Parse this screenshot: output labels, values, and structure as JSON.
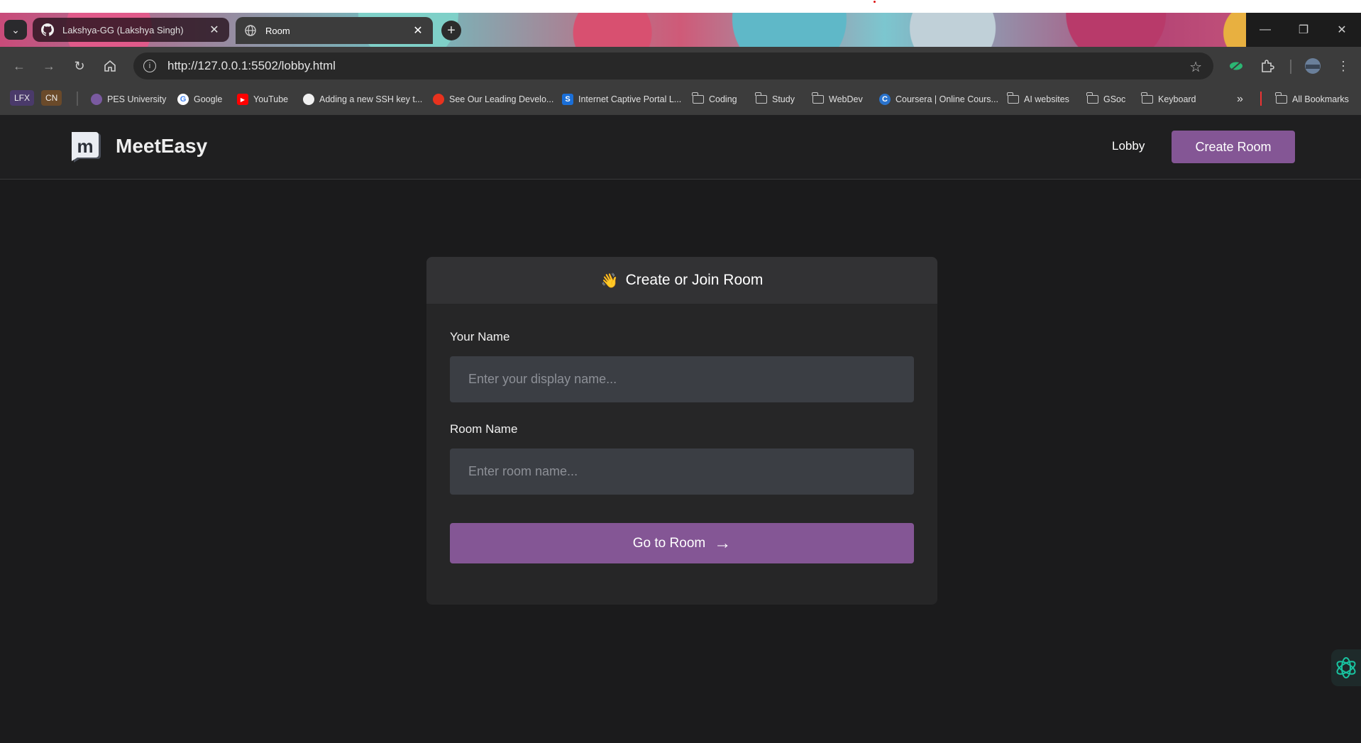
{
  "browser": {
    "tabs": [
      {
        "title": "Lakshya-GG (Lakshya Singh)",
        "icon": "github-icon",
        "active": false
      },
      {
        "title": "Room",
        "icon": "globe-icon",
        "active": true
      }
    ],
    "new_tab_symbol": "+",
    "tab_close_symbol": "✕",
    "url": "http://127.0.0.1:5502/lobby.html",
    "bookmarks": {
      "chips": [
        "LFX",
        "CN"
      ],
      "items": [
        {
          "label": "PES University",
          "icon": "pes-icon"
        },
        {
          "label": "Google",
          "icon": "google-icon"
        },
        {
          "label": "YouTube",
          "icon": "youtube-icon"
        },
        {
          "label": "Adding a new SSH key t...",
          "icon": "github-icon"
        },
        {
          "label": "See Our Leading Develo...",
          "icon": "red-circle-icon"
        },
        {
          "label": "Internet Captive Portal L...",
          "icon": "sophos-icon"
        },
        {
          "label": "Coding",
          "icon": "folder-icon"
        },
        {
          "label": "Study",
          "icon": "folder-icon"
        },
        {
          "label": "WebDev",
          "icon": "folder-icon"
        },
        {
          "label": "Coursera | Online Cours...",
          "icon": "coursera-icon"
        },
        {
          "label": "AI websites",
          "icon": "folder-icon"
        },
        {
          "label": "GSoc",
          "icon": "folder-icon"
        },
        {
          "label": "Keyboard",
          "icon": "folder-icon"
        }
      ],
      "overflow": "»",
      "all_bookmarks": "All Bookmarks"
    }
  },
  "app": {
    "brand": "MeetEasy",
    "logo_letter": "m",
    "nav": {
      "lobby": "Lobby",
      "create_room": "Create Room"
    },
    "card": {
      "title": "Create or Join Room",
      "wave_emoji": "👋",
      "name_label": "Your Name",
      "name_placeholder": "Enter your display name...",
      "name_value": "",
      "room_label": "Room Name",
      "room_placeholder": "Enter room name...",
      "room_value": "",
      "submit": "Go to Room",
      "submit_arrow": "→"
    },
    "colors": {
      "accent": "#845695",
      "background": "#1b1b1c",
      "card": "#262627",
      "input": "#3b3e44"
    }
  }
}
